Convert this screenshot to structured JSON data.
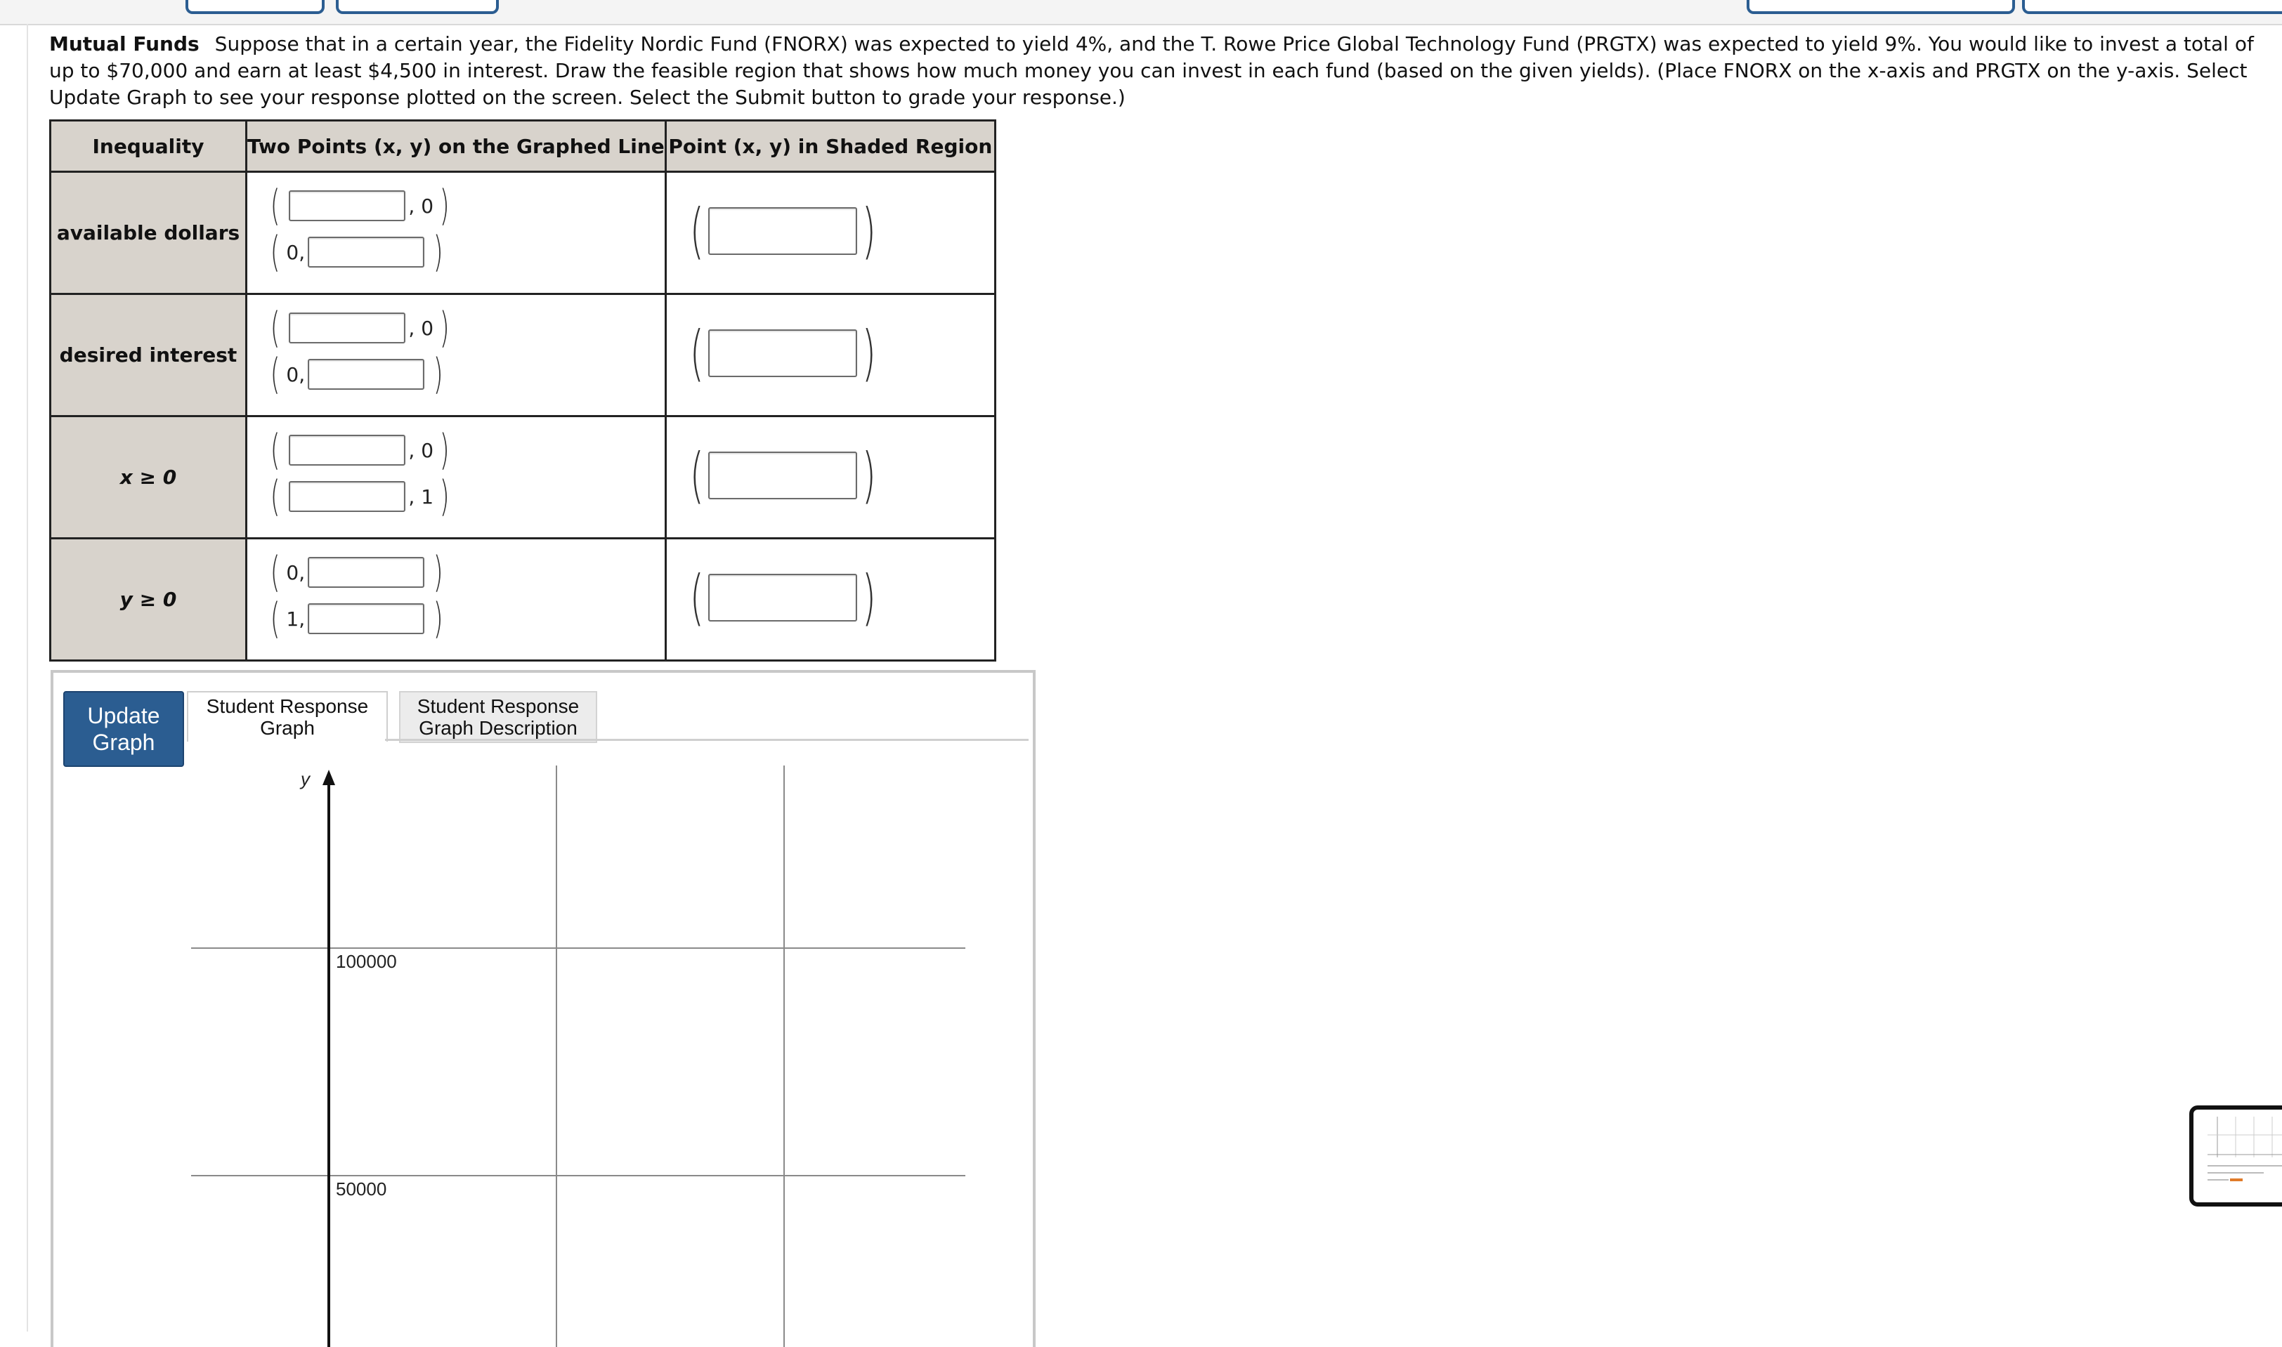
{
  "problem": {
    "title": "Mutual Funds",
    "text": "Suppose that in a certain year, the Fidelity Nordic Fund (FNORX) was expected to yield 4%, and the T. Rowe Price Global Technology Fund (PRGTX) was expected to yield 9%. You would like to invest a total of up to $70,000 and earn at least $4,500 in interest. Draw the feasible region that shows how much money you can invest in each fund (based on the given yields). (Place FNORX on the x-axis and PRGTX on the y-axis. Select Update Graph to see your response plotted on the screen. Select the Submit button to grade your response.)"
  },
  "table": {
    "headers": [
      "Inequality",
      "Two Points (x, y) on the Graphed Line",
      "Point (x, y) in Shaded Region"
    ],
    "rows": [
      {
        "label": "available dollars",
        "p1_prefix": "",
        "p1_suffix": ", 0",
        "p2_prefix": "0,",
        "p2_suffix": ""
      },
      {
        "label": "desired interest",
        "p1_prefix": "",
        "p1_suffix": ", 0",
        "p2_prefix": "0,",
        "p2_suffix": ""
      },
      {
        "label": "x ≥ 0",
        "p1_prefix": "",
        "p1_suffix": ", 0",
        "p2_prefix": "",
        "p2_suffix": ", 1"
      },
      {
        "label": "y ≥ 0",
        "p1_prefix": "0,",
        "p1_suffix": "",
        "p2_prefix": "1,",
        "p2_suffix": ""
      }
    ]
  },
  "graph": {
    "update_label": "Update Graph",
    "tabs": [
      "Student Response Graph",
      "Student Response Graph Description"
    ],
    "y_axis_label": "y",
    "y_ticks": [
      "100000",
      "50000"
    ]
  },
  "colors": {
    "button_blue": "#2b5d91",
    "table_header": "#d8d3cc"
  }
}
